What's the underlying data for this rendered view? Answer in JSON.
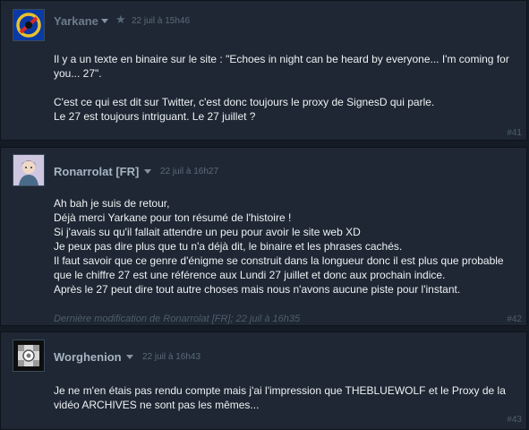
{
  "posts": [
    {
      "author": "Yarkane",
      "date": "22 juil à 15h46",
      "paragraphs": [
        "Il y a un texte en binaire sur le site : \"Echoes in night can be heard by everyone... I'm coming for you... 27\".",
        "C'est ce qui est dit sur Twitter, c'est donc toujours le proxy de SignesD qui parle.\nLe 27 est toujours intriguant. Le 27 juillet ?"
      ],
      "number": "#41"
    },
    {
      "author": "Ronarrolat [FR]",
      "date": "22 juil à 16h27",
      "paragraphs": [
        "Ah bah je suis de retour,\nDéjà merci Yarkane pour ton résumé de l'histoire !\nSi j'avais su qu'il fallait attendre un peu pour avoir le site web XD\nJe peux pas dire plus que tu n'a déjà dit, le binaire et les phrases cachés.\nIl faut savoir que ce genre d'énigme se construit dans la longueur donc il est plus que probable que le chiffre 27 est une référence aux Lundi 27 juillet et donc aux prochain indice.\nAprès le 27 peut dire tout autre choses mais nous n'avons aucune piste pour l'instant."
      ],
      "edited": "Dernière modification de Ronarrolat [FR]; 22 juil à 16h35",
      "number": "#42"
    },
    {
      "author": "Worghenion",
      "date": "22 juil à 16h43",
      "paragraphs": [
        "Je ne m'en étais pas rendu compte mais j'ai l'impression que THEBLUEWOLF et le Proxy de la vidéo ARCHIVES ne sont pas les mêmes..."
      ],
      "number": "#43"
    }
  ]
}
